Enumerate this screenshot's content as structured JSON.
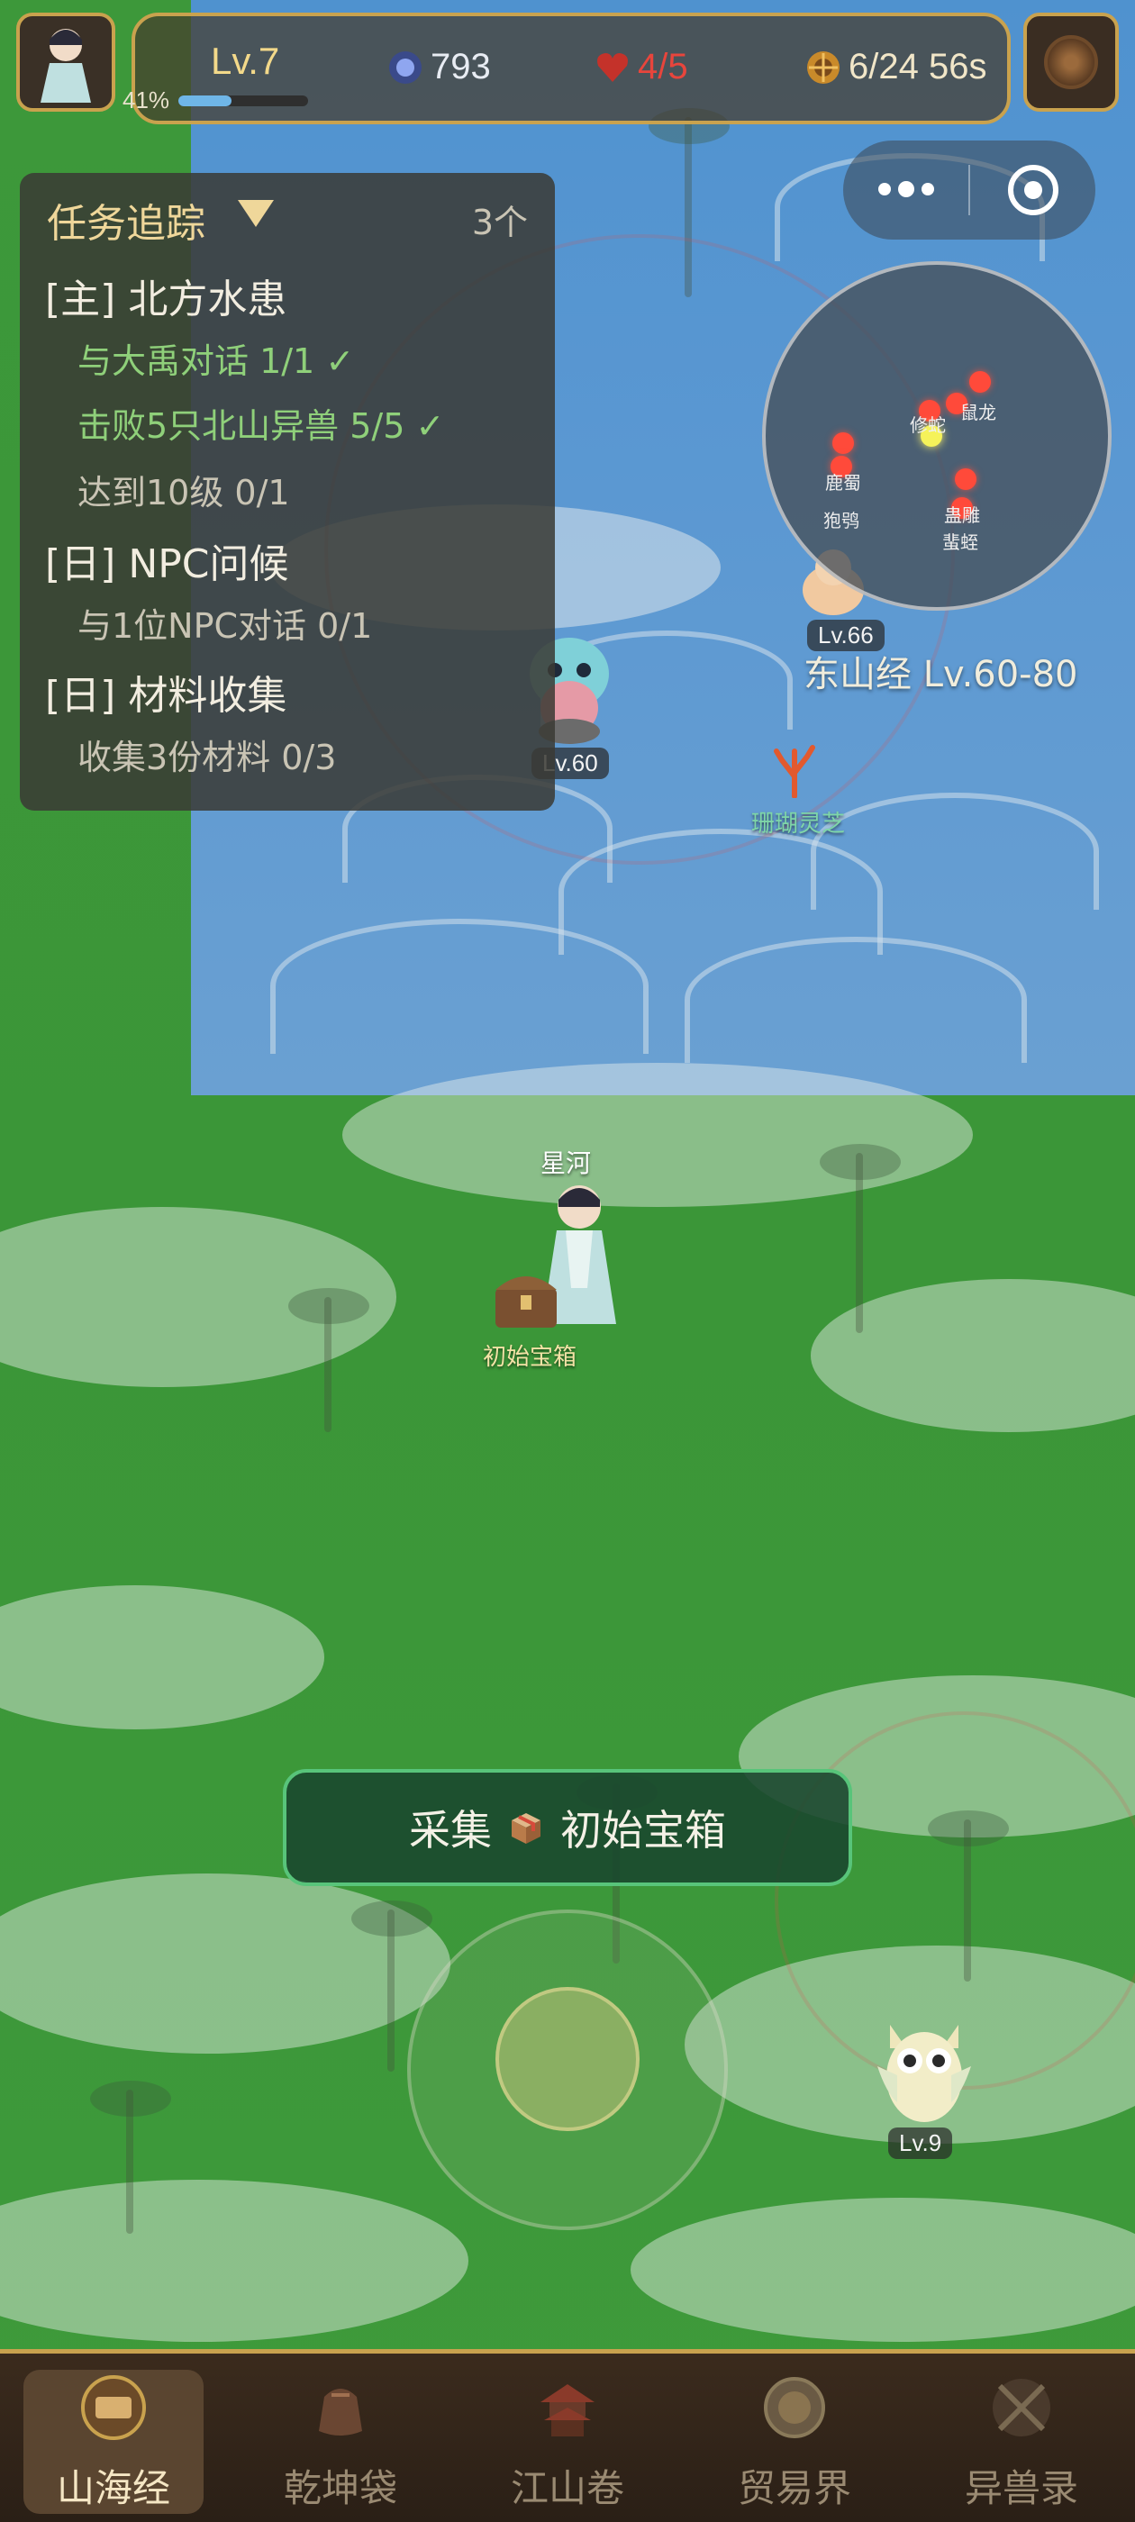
{
  "hud": {
    "level": "Lv.7",
    "exp_percent": "41%",
    "exp_fraction": 0.41,
    "jade": "793",
    "stamina": "4/5",
    "capture": "6/24 56s"
  },
  "quest": {
    "title": "任务追踪",
    "count": "3个",
    "groups": [
      {
        "heading": "[主] 北方水患",
        "lines": [
          {
            "text": "与大禹对话 1/1 ✓",
            "done": true
          },
          {
            "text": "击败5只北山异兽 5/5 ✓",
            "done": true
          },
          {
            "text": "达到10级 0/1",
            "done": false
          }
        ]
      },
      {
        "heading": "[日] NPC问候",
        "lines": [
          {
            "text": "与1位NPC对话 0/1",
            "done": false
          }
        ]
      },
      {
        "heading": "[日] 材料收集",
        "lines": [
          {
            "text": "收集3份材料 0/3",
            "done": false
          }
        ]
      }
    ]
  },
  "minimap": {
    "labels": [
      "鼠龙",
      "修蛇",
      "鹿蜀",
      "狍鸮",
      "蛊雕",
      "蜚蛭"
    ]
  },
  "map": {
    "zone": "东山经 Lv.60-80",
    "monsters": [
      {
        "level": "Lv.66"
      },
      {
        "level": "Lv.60"
      },
      {
        "level": "Lv.9"
      }
    ],
    "herb": "珊瑚灵芝",
    "chest": "初始宝箱",
    "player_name": "星河"
  },
  "gather": {
    "label": "采集",
    "target": "初始宝箱"
  },
  "nav": {
    "tabs": [
      "山海经",
      "乾坤袋",
      "江山卷",
      "贸易界",
      "异兽录"
    ],
    "active_index": 0
  },
  "colors": {
    "accent_gold": "#c9a24e",
    "done_green": "#8fd07a",
    "stamina_red": "#e8453c"
  }
}
